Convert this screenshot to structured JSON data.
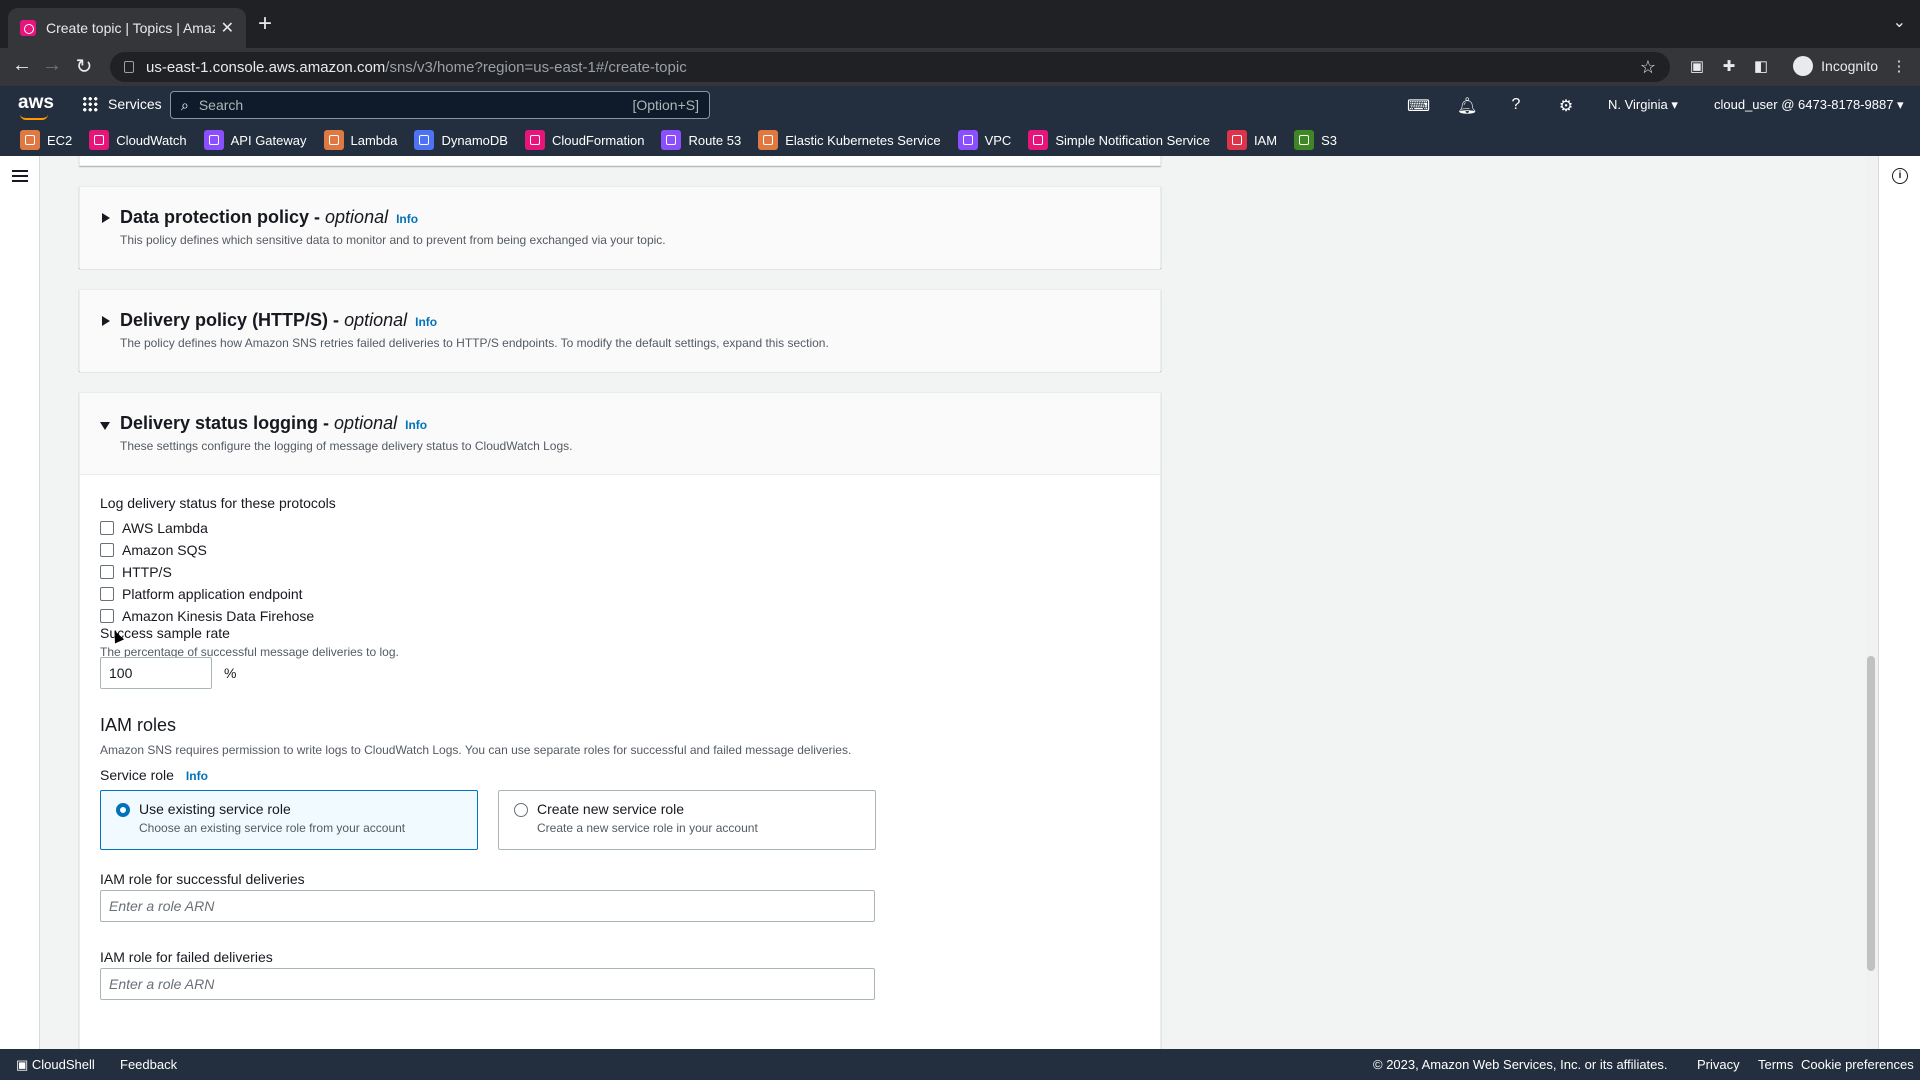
{
  "browser": {
    "tab_title": "Create topic | Topics | Amazon",
    "url_host": "us-east-1.console.aws.amazon.com",
    "url_path": "/sns/v3/home?region=us-east-1#/create-topic",
    "profile_label": "Incognito"
  },
  "aws_header": {
    "logo": "aws",
    "services_label": "Services",
    "search_placeholder": "Search",
    "search_shortcut": "[Option+S]",
    "region": "N. Virginia ▾",
    "account": "cloud_user @ 6473-8178-9887 ▾"
  },
  "favorites": [
    {
      "label": "EC2",
      "color": "#e07941"
    },
    {
      "label": "CloudWatch",
      "color": "#e7157b"
    },
    {
      "label": "API Gateway",
      "color": "#8c4fff"
    },
    {
      "label": "Lambda",
      "color": "#e07941"
    },
    {
      "label": "DynamoDB",
      "color": "#4d72f3"
    },
    {
      "label": "CloudFormation",
      "color": "#e7157b"
    },
    {
      "label": "Route 53",
      "color": "#8c4fff"
    },
    {
      "label": "Elastic Kubernetes Service",
      "color": "#e07941"
    },
    {
      "label": "VPC",
      "color": "#8c4fff"
    },
    {
      "label": "Simple Notification Service",
      "color": "#e7157b"
    },
    {
      "label": "IAM",
      "color": "#dd344c"
    },
    {
      "label": "S3",
      "color": "#3f8624"
    }
  ],
  "sections": {
    "data_protection": {
      "title": "Data protection policy - ",
      "optional": "optional",
      "info": "Info",
      "desc": "This policy defines which sensitive data to monitor and to prevent from being exchanged via your topic."
    },
    "delivery_policy": {
      "title": "Delivery policy (HTTP/S) - ",
      "optional": "optional",
      "info": "Info",
      "desc": "The policy defines how Amazon SNS retries failed deliveries to HTTP/S endpoints. To modify the default settings, expand this section."
    },
    "delivery_logging": {
      "title": "Delivery status logging - ",
      "optional": "optional",
      "info": "Info",
      "desc": "These settings configure the logging of message delivery status to CloudWatch Logs.",
      "protocols_label": "Log delivery status for these protocols",
      "protocols": [
        "AWS Lambda",
        "Amazon SQS",
        "HTTP/S",
        "Platform application endpoint",
        "Amazon Kinesis Data Firehose"
      ],
      "sample_rate_label": "Success sample rate",
      "sample_rate_desc": "The percentage of successful message deliveries to log.",
      "sample_rate_value": "100",
      "sample_rate_unit": "%",
      "iam_title": "IAM roles",
      "iam_desc": "Amazon SNS requires permission to write logs to CloudWatch Logs. You can use separate roles for successful and failed message deliveries.",
      "service_role_label": "Service role",
      "service_role_info": "Info",
      "role_options": [
        {
          "title": "Use existing service role",
          "desc": "Choose an existing service role from your account",
          "selected": true
        },
        {
          "title": "Create new service role",
          "desc": "Create a new service role in your account",
          "selected": false
        }
      ],
      "success_role_label": "IAM role for successful deliveries",
      "success_role_placeholder": "Enter a role ARN",
      "failed_role_label": "IAM role for failed deliveries",
      "failed_role_placeholder": "Enter a role ARN"
    }
  },
  "footer": {
    "cloudshell": "CloudShell",
    "feedback": "Feedback",
    "copyright": "© 2023, Amazon Web Services, Inc. or its affiliates.",
    "privacy": "Privacy",
    "terms": "Terms",
    "cookies": "Cookie preferences"
  }
}
